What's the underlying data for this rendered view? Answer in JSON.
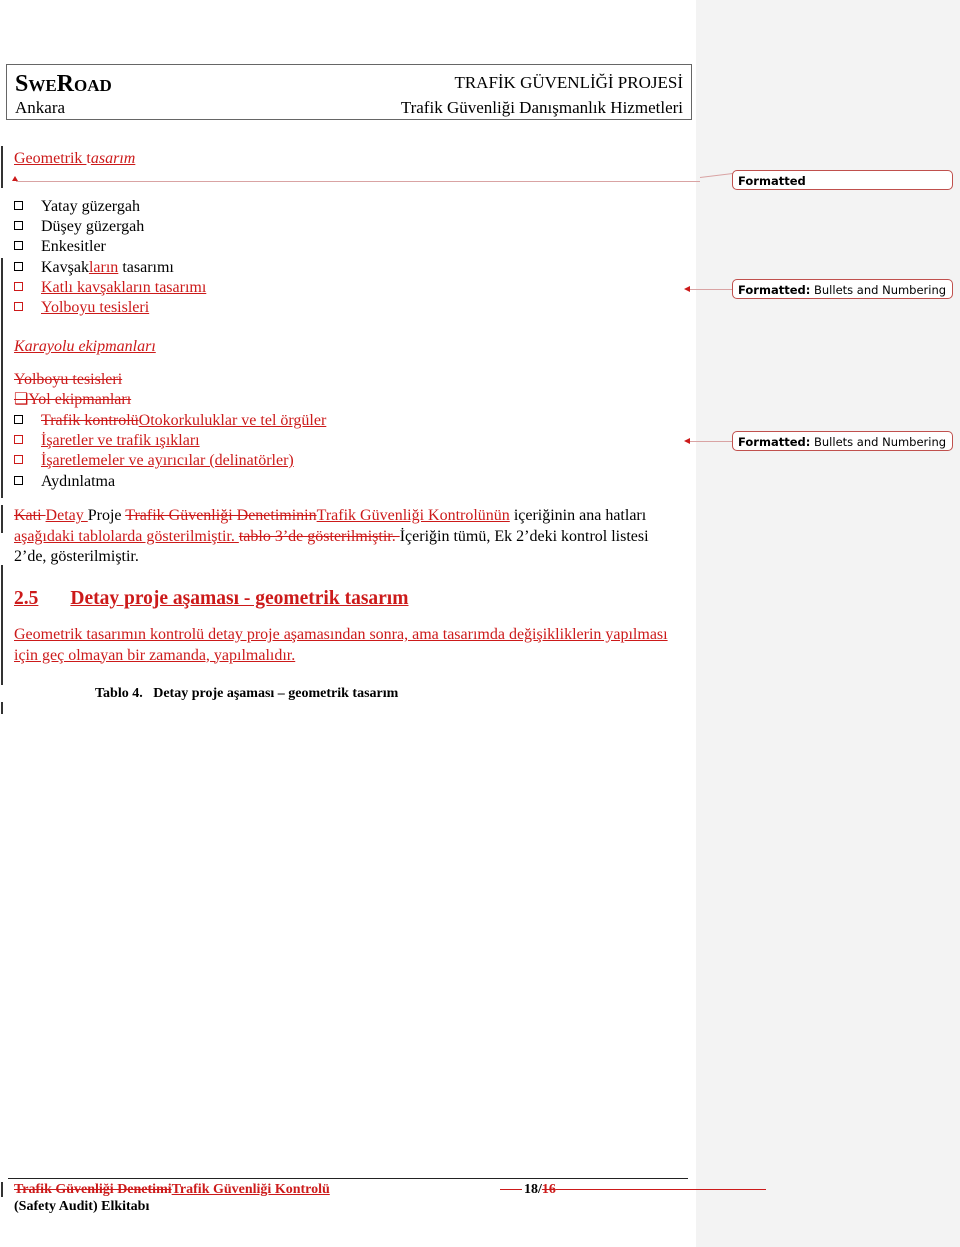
{
  "header": {
    "logo": "SweRoad",
    "city": "Ankara",
    "project_title": "TRAFİK GÜVENLİĞİ PROJESİ",
    "project_subtitle": "Trafik Güvenliği Danışmanlık Hizmetleri"
  },
  "section1": {
    "title_part1": "Geometrik ",
    "title_part2": "t",
    "title_part3": "asarım",
    "bullets": [
      {
        "text": "Yatay güzergah",
        "style": "normal"
      },
      {
        "text": "Düşey güzergah",
        "style": "normal"
      },
      {
        "text": "Enkesitler",
        "style": "normal"
      },
      {
        "text_a": "Kavşak",
        "text_b": "ların",
        "text_c": " tasarımı",
        "style": "mixed"
      },
      {
        "text": "Katlı kavşakların tasarımı",
        "style": "inserted"
      },
      {
        "text": "Yolboyu tesisleri",
        "style": "inserted"
      }
    ]
  },
  "section2": {
    "title": "Karayolu ekipmanları",
    "deleted_line1": "Yolboyu tesisleri",
    "deleted_line2": "❑Yol ekipmanları",
    "bullets": [
      {
        "deleted": "Trafik kontrolü",
        "inserted": "Otokorkuluklar ve tel örgüler"
      },
      {
        "inserted": "İşaretler ve trafik ışıkları"
      },
      {
        "inserted": "İşaretlemeler ve ayırıcılar (delinatörler)"
      },
      {
        "normal": "Aydınlatma"
      }
    ]
  },
  "paragraph1": {
    "del1": "Kati ",
    "ins1": "Detay ",
    "t1": "Proje ",
    "del2": "Trafik Güvenliği Denetiminin",
    "ins2": "Trafik Güvenliği Kontrolünün",
    "t2": " içeriğinin ana hatları",
    "ins3": " aşağıdaki tablolarda gösterilmiştir. ",
    "del3": " tablo 3’de gösterilmiştir. ",
    "t3": "İçeriğin tümü, Ek 2’deki kontrol listesi 2’de, gösterilmiştir."
  },
  "heading": {
    "number": "2.5",
    "title": "Detay proje aşaması - geometrik tasarım"
  },
  "paragraph2": "Geometrik tasarımın kontrolü detay proje aşamasından sonra, ama tasarımda değişikliklerin yapılması için geç olmayan bir zamanda, yapılmalıdır.",
  "caption": "Tablo 4.   Detay proje aşaması – geometrik tasarım",
  "comments": [
    {
      "label": "Formatted",
      "detail": ""
    },
    {
      "label": "Formatted:",
      "detail": " Bullets and Numbering"
    },
    {
      "label": "Formatted:",
      "detail": " Bullets and Numbering"
    }
  ],
  "footer": {
    "deleted": "Trafik Güvenliği Denetimi",
    "inserted": "Trafik Güvenliği Kontrolü",
    "line2": "(Safety Audit) Elkitabı",
    "page_current": "18/",
    "page_deleted": "16"
  },
  "colors": {
    "revision_red": "#cc1a1a",
    "balloon_border": "#c0504d",
    "margin_pane": "#f3f3f3"
  }
}
